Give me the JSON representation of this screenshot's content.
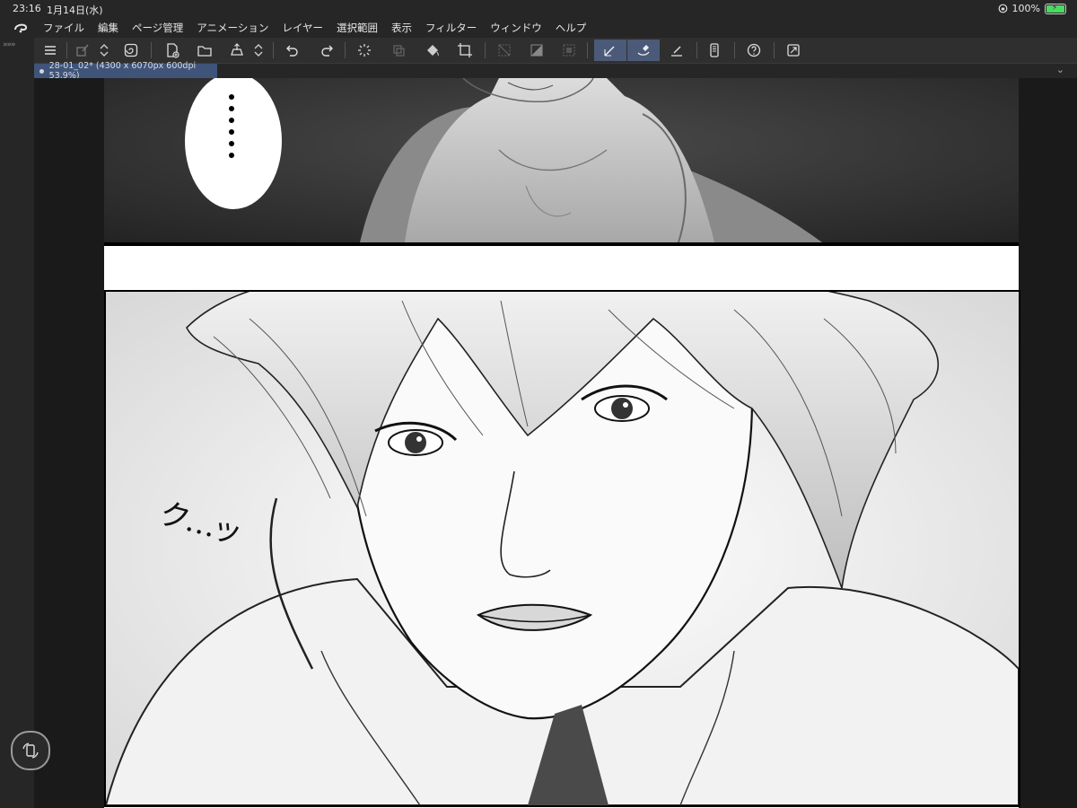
{
  "status_bar": {
    "time": "23:16",
    "date": "1月14日(水)",
    "battery": "100%"
  },
  "menu": {
    "items": [
      "ファイル",
      "編集",
      "ページ管理",
      "アニメーション",
      "レイヤー",
      "選択範囲",
      "表示",
      "フィルター",
      "ウィンドウ",
      "ヘルプ"
    ]
  },
  "tab": {
    "title": "28-01_02* (4300 x 6070px 600dpi 53.9%)"
  },
  "artwork": {
    "sfx_text": "ク…ッ"
  },
  "colors": {
    "accent": "#4a5a78",
    "tab_active": "#3f5478",
    "battery": "#4cd964",
    "ui_bg": "#262626",
    "toolbar_bg": "#2f2f2f"
  }
}
